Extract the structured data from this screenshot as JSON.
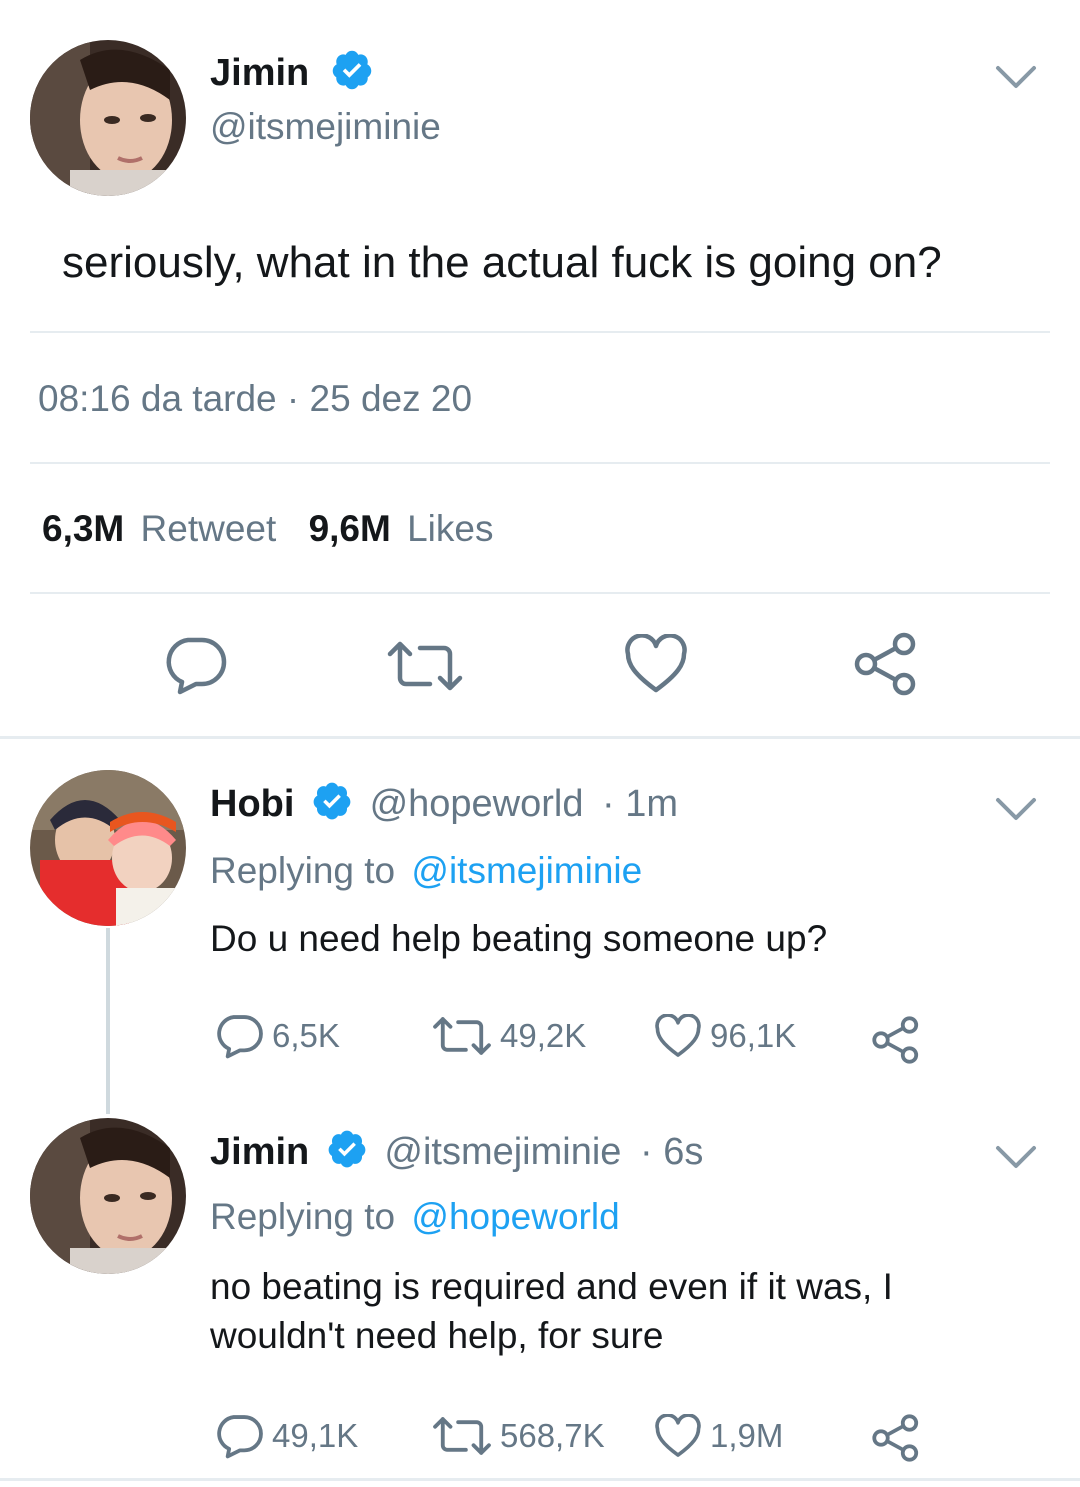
{
  "main_tweet": {
    "author_name": "Jimin",
    "author_handle": "@itsmejiminie",
    "text": "seriously, what in the actual fuck is going on?",
    "timestamp": "08:16 da tarde · 25 dez 20",
    "retweets_count": "6,3M",
    "retweets_label": "Retweet",
    "likes_count": "9,6M",
    "likes_label": "Likes",
    "avatar_icon": "person-avatar",
    "actions": [
      "reply-icon",
      "retweet-icon",
      "like-icon",
      "share-icon"
    ]
  },
  "replies": [
    {
      "author_name": "Hobi",
      "author_handle": "@hopeworld",
      "time": "· 1m",
      "replying_prefix": "Replying to",
      "replying_to": "@itsmejiminie",
      "text": "Do u need help beating someone up?",
      "reply_count": "6,5K",
      "retweet_count": "49,2K",
      "like_count": "96,1K"
    },
    {
      "author_name": "Jimin",
      "author_handle": "@itsmejiminie",
      "time": "· 6s",
      "replying_prefix": "Replying to",
      "replying_to": "@hopeworld",
      "text_line1": "no beating is required and even if it was, I",
      "text_line2": "wouldn't need help, for sure",
      "reply_count": "49,1K",
      "retweet_count": "568,7K",
      "like_count": "1,9M"
    }
  ],
  "colors": {
    "verified": "#1da1f2",
    "link": "#1da1f2",
    "secondary_text": "#657786",
    "divider": "#e6ecf0"
  }
}
